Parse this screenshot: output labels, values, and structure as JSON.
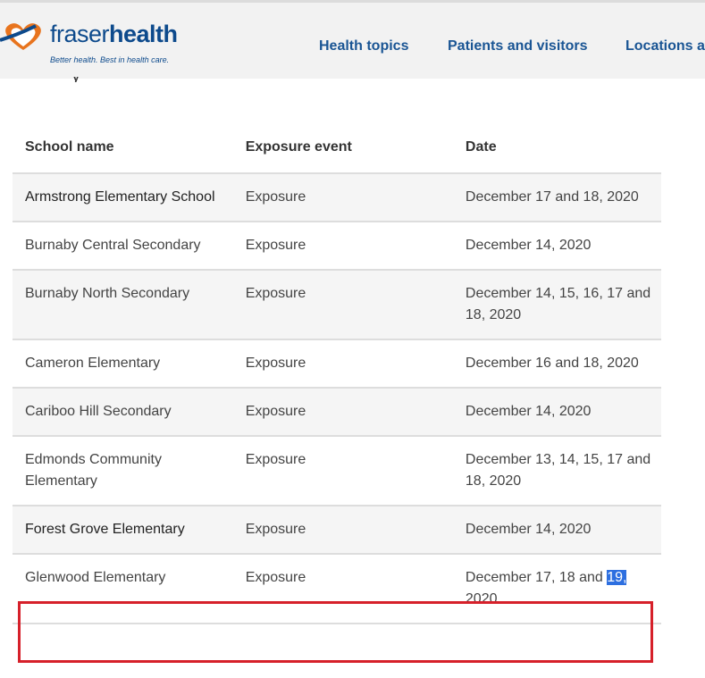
{
  "header": {
    "logo_text_a": "fraser",
    "logo_text_b": "health",
    "tagline": "Better health. Best in health care.",
    "nav": [
      "Health topics",
      "Patients and visitors",
      "Locations a"
    ],
    "cut_text": "y"
  },
  "table": {
    "headers": [
      "School name",
      "Exposure event",
      "Date"
    ],
    "rows": [
      {
        "school": "Armstrong Elementary School",
        "event": "Exposure",
        "date": "December 17 and 18, 2020"
      },
      {
        "school": "Burnaby Central Secondary",
        "event": "Exposure",
        "date": "December 14, 2020"
      },
      {
        "school": "Burnaby North Secondary",
        "event": "Exposure",
        "date": "December 14, 15, 16, 17 and 18, 2020"
      },
      {
        "school": "Cameron Elementary",
        "event": "Exposure",
        "date": "December 16 and 18, 2020"
      },
      {
        "school": "Cariboo Hill Secondary",
        "event": "Exposure",
        "date": "December 14, 2020"
      },
      {
        "school": "Edmonds Community Elementary",
        "event": "Exposure",
        "date": "December 13, 14, 15, 17 and 18, 2020"
      },
      {
        "school": "Forest Grove Elementary",
        "event": "Exposure",
        "date": "December 14, 2020"
      },
      {
        "school": "Glenwood Elementary",
        "event": "Exposure",
        "date_prefix": "December 17, 18 and ",
        "date_selected": "19,",
        "date_suffix": " 2020"
      }
    ]
  },
  "colors": {
    "brand_blue": "#0d4a8c",
    "accent_red": "#d6202a",
    "selection": "#2d6fe0"
  }
}
